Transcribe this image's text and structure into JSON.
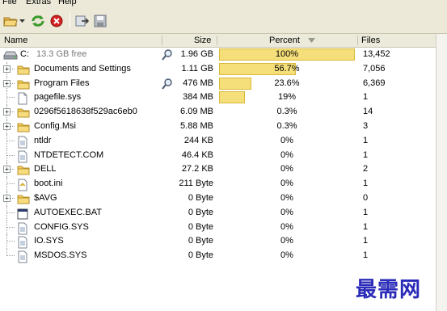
{
  "menu": [
    "File",
    "Extras",
    "Help"
  ],
  "toolbar": {
    "buttons": [
      {
        "name": "open-folder-icon",
        "color": "#e8b84a"
      },
      {
        "name": "dropdown-arrow-icon",
        "color": "#333333"
      },
      {
        "name": "refresh-icon",
        "color": "#3a9a2a"
      },
      {
        "name": "stop-icon",
        "color": "#d12020"
      },
      {
        "name": "export-icon",
        "color": "#6c7a8a"
      },
      {
        "name": "save-icon",
        "color": "#8a8f96"
      }
    ]
  },
  "columns": {
    "name": "Name",
    "size": "Size",
    "percent": "Percent",
    "files": "Files"
  },
  "colors": {
    "bar_fill": "#f5df7a",
    "bar_border": "#d9b93a",
    "folder": "#f2cf5b"
  },
  "rows": [
    {
      "kind": "drive",
      "label": "C:",
      "extra": "13.3 GB free",
      "size": "1.96 GB",
      "percent": "100%",
      "ratio": 1.0,
      "files": "13,452",
      "search": true
    },
    {
      "kind": "folder",
      "expand": true,
      "label": "Documents and Settings",
      "size": "1.11 GB",
      "percent": "56.7%",
      "ratio": 0.567,
      "files": "7,056"
    },
    {
      "kind": "folder",
      "expand": true,
      "label": "Program Files",
      "size": "476 MB",
      "percent": "23.6%",
      "ratio": 0.236,
      "files": "6,369",
      "search": true
    },
    {
      "kind": "file",
      "label": "pagefile.sys",
      "size": "384 MB",
      "percent": "19%",
      "ratio": 0.19,
      "files": "1"
    },
    {
      "kind": "folder",
      "expand": true,
      "label": "0296f5618638f529ac6eb0",
      "size": "6.09 MB",
      "percent": "0.3%",
      "ratio": 0.003,
      "files": "14"
    },
    {
      "kind": "folder",
      "expand": true,
      "label": "Config.Msi",
      "size": "5.88 MB",
      "percent": "0.3%",
      "ratio": 0.003,
      "files": "3"
    },
    {
      "kind": "sysfile",
      "label": "ntldr",
      "size": "244 KB",
      "percent": "0%",
      "ratio": 0,
      "files": "1"
    },
    {
      "kind": "sysfile",
      "label": "NTDETECT.COM",
      "size": "46.4 KB",
      "percent": "0%",
      "ratio": 0,
      "files": "1"
    },
    {
      "kind": "folder",
      "expand": true,
      "label": "DELL",
      "size": "27.2 KB",
      "percent": "0%",
      "ratio": 0,
      "files": "2"
    },
    {
      "kind": "inifile",
      "label": "boot.ini",
      "size": "211 Byte",
      "percent": "0%",
      "ratio": 0,
      "files": "1"
    },
    {
      "kind": "folder",
      "expand": true,
      "label": "$AVG",
      "size": "0 Byte",
      "percent": "0%",
      "ratio": 0,
      "files": "0"
    },
    {
      "kind": "batfile",
      "label": "AUTOEXEC.BAT",
      "size": "0 Byte",
      "percent": "0%",
      "ratio": 0,
      "files": "1"
    },
    {
      "kind": "sysfile",
      "label": "CONFIG.SYS",
      "size": "0 Byte",
      "percent": "0%",
      "ratio": 0,
      "files": "1"
    },
    {
      "kind": "sysfile",
      "label": "IO.SYS",
      "size": "0 Byte",
      "percent": "0%",
      "ratio": 0,
      "files": "1"
    },
    {
      "kind": "sysfile",
      "label": "MSDOS.SYS",
      "size": "0 Byte",
      "percent": "0%",
      "ratio": 0,
      "files": "1"
    }
  ],
  "watermark": "最需网"
}
